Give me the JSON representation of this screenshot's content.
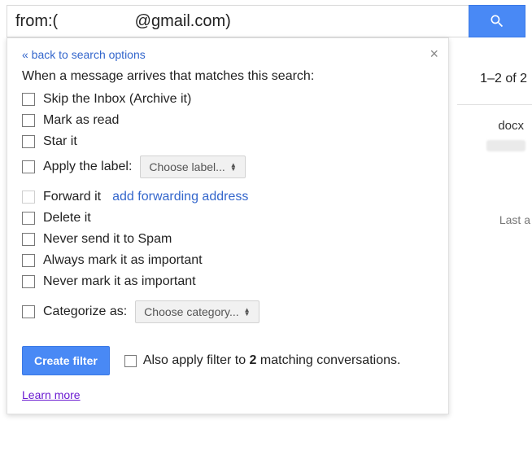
{
  "search": {
    "value": "from:(                 @gmail.com)"
  },
  "panel": {
    "back": "« back to search options",
    "intro": "When a message arrives that matches this search:",
    "options": {
      "skip": "Skip the Inbox (Archive it)",
      "read": "Mark as read",
      "star": "Star it",
      "label": "Apply the label:",
      "label_dd": "Choose label...",
      "forward": "Forward it",
      "forward_link": "add forwarding address",
      "delete": "Delete it",
      "nospam": "Never send it to Spam",
      "imp": "Always mark it as important",
      "noimp": "Never mark it as important",
      "cat": "Categorize as:",
      "cat_dd": "Choose category..."
    },
    "create": "Create filter",
    "also_prefix": "Also apply filter to ",
    "also_count": "2",
    "also_suffix": " matching conversations.",
    "learn": "Learn more"
  },
  "background": {
    "count": "1–2 of 2",
    "file": "docx",
    "last": "Last a"
  }
}
